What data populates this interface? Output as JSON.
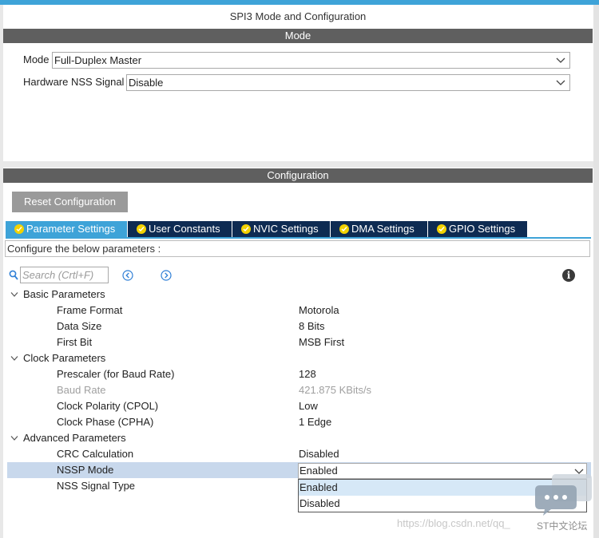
{
  "window": {
    "title": "SPI3 Mode and Configuration"
  },
  "mode_section": {
    "header": "Mode",
    "fields": [
      {
        "label": "Mode",
        "value": "Full-Duplex Master"
      },
      {
        "label": "Hardware NSS Signal",
        "value": "Disable"
      }
    ]
  },
  "config_section": {
    "header": "Configuration",
    "reset_label": "Reset Configuration",
    "tabs": [
      {
        "label": "Parameter Settings",
        "active": true
      },
      {
        "label": "User Constants",
        "active": false
      },
      {
        "label": "NVIC Settings",
        "active": false
      },
      {
        "label": "DMA Settings",
        "active": false
      },
      {
        "label": "GPIO Settings",
        "active": false
      }
    ],
    "hint": "Configure the below parameters :",
    "search": {
      "placeholder": "Search (Crtl+F)"
    },
    "groups": [
      {
        "name": "Basic Parameters",
        "params": [
          {
            "name": "Frame Format",
            "value": "Motorola"
          },
          {
            "name": "Data Size",
            "value": "8 Bits"
          },
          {
            "name": "First Bit",
            "value": "MSB First"
          }
        ]
      },
      {
        "name": "Clock Parameters",
        "params": [
          {
            "name": "Prescaler (for Baud Rate)",
            "value": "128"
          },
          {
            "name": "Baud Rate",
            "value": "421.875 KBits/s",
            "disabled": true
          },
          {
            "name": "Clock Polarity (CPOL)",
            "value": "Low"
          },
          {
            "name": "Clock Phase (CPHA)",
            "value": "1 Edge"
          }
        ]
      },
      {
        "name": "Advanced Parameters",
        "params": [
          {
            "name": "CRC Calculation",
            "value": "Disabled"
          },
          {
            "name": "NSSP Mode",
            "value": "Enabled",
            "selected": true
          },
          {
            "name": "NSS Signal Type",
            "value": ""
          }
        ]
      }
    ],
    "dropdown": {
      "current": "Enabled",
      "options": [
        "Enabled",
        "Disabled"
      ],
      "highlighted": "Enabled"
    }
  },
  "watermark": {
    "url": "https://blog.csdn.net/qq_",
    "site": "ST中文论坛"
  },
  "colors": {
    "accent": "#3ea3d8",
    "tab_dark": "#0e2b52",
    "section_bar": "#5f5f5f",
    "selected_row": "#c8d8ec",
    "check_badge": "#f3d200"
  }
}
